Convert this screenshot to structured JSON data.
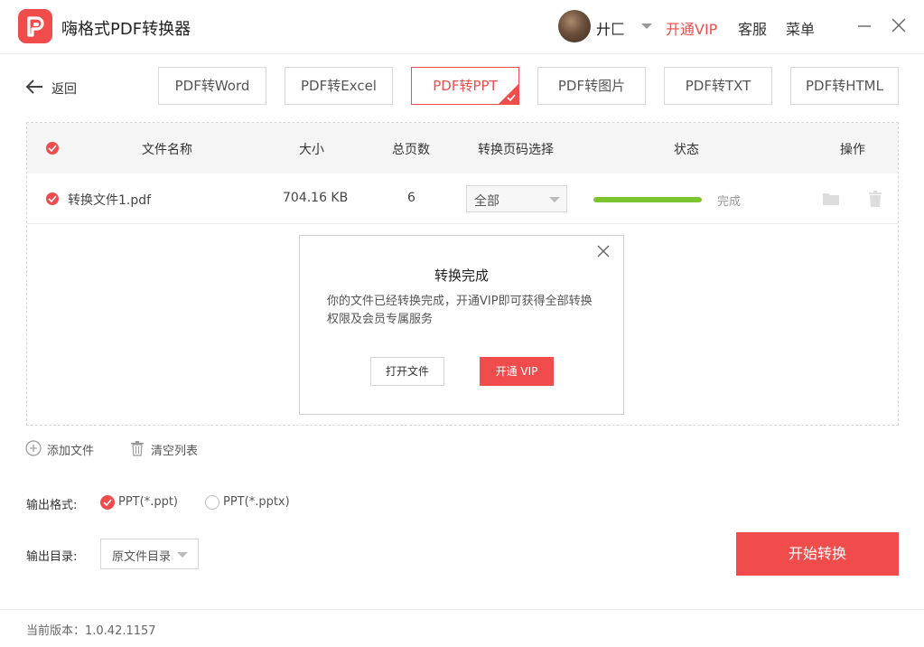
{
  "app": {
    "title": "嗨格式PDF转换器",
    "username": "廾匚",
    "vip_link": "开通VIP",
    "service_link": "客服",
    "menu_link": "菜单"
  },
  "nav": {
    "back_label": "返回",
    "tabs": [
      {
        "label": "PDF转Word",
        "active": false
      },
      {
        "label": "PDF转Excel",
        "active": false
      },
      {
        "label": "PDF转PPT",
        "active": true
      },
      {
        "label": "PDF转图片",
        "active": false
      },
      {
        "label": "PDF转TXT",
        "active": false
      },
      {
        "label": "PDF转HTML",
        "active": false
      }
    ]
  },
  "table": {
    "headers": {
      "file_name": "文件名称",
      "size": "大小",
      "pages": "总页数",
      "page_select": "转换页码选择",
      "status": "状态",
      "actions": "操作"
    },
    "rows": [
      {
        "file_name": "转换文件1.pdf",
        "size": "704.16 KB",
        "pages": "6",
        "page_select": "全部",
        "progress": 1.0,
        "status": "完成"
      }
    ]
  },
  "dialog": {
    "title": "转换完成",
    "message": "你的文件已经转换完成，开通VIP即可获得全部转换权限及会员专属服务",
    "open_button": "打开文件",
    "vip_button": "开通 VIP"
  },
  "actions": {
    "add_file": "添加文件",
    "clear_list": "清空列表"
  },
  "output": {
    "format_label": "输出格式:",
    "format_options": [
      {
        "label": "PPT(*.ppt)",
        "selected": true
      },
      {
        "label": "PPT(*.pptx)",
        "selected": false
      }
    ],
    "dir_label": "输出目录:",
    "dir_value": "原文件目录"
  },
  "start_button": "开始转换",
  "footer": {
    "version": "当前版本：1.0.42.1157"
  },
  "colors": {
    "accent": "#f04c4c",
    "progress": "#7cc42f"
  },
  "icons": [
    "app-logo-icon",
    "back-arrow-icon",
    "chevron-down-icon",
    "minimize-icon",
    "close-icon",
    "check-icon",
    "folder-icon",
    "trash-icon",
    "add-circle-icon"
  ]
}
